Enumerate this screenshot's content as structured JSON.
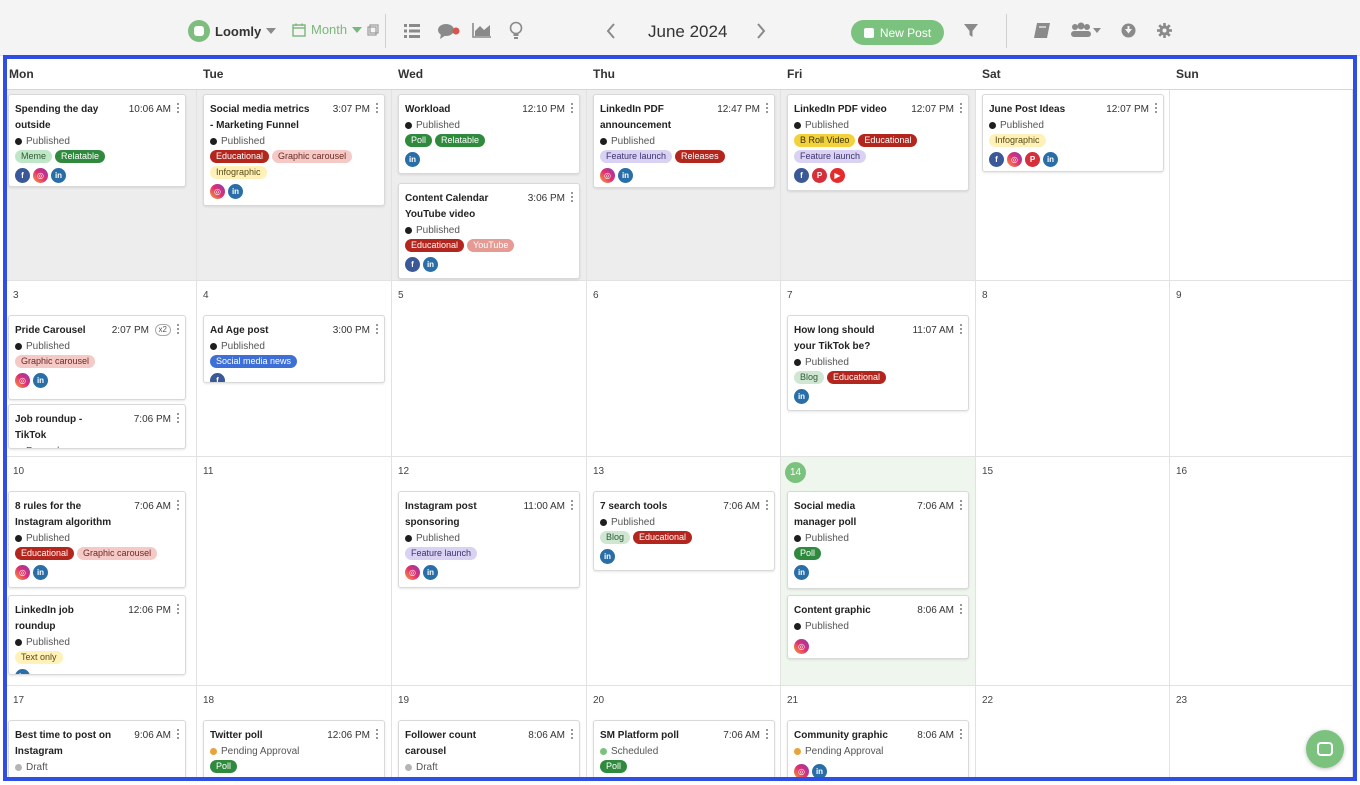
{
  "toolbar": {
    "brand": "Loomly",
    "view": "Month",
    "month_title": "June 2024",
    "new_post": "New Post",
    "accent": "#7bc27f",
    "icons": [
      "list-view-icon",
      "comments-icon",
      "analytics-icon",
      "ideas-icon",
      "filter-icon",
      "library-icon",
      "team-icon",
      "download-icon",
      "settings-icon"
    ]
  },
  "day_headers": [
    "Mon",
    "Tue",
    "Wed",
    "Thu",
    "Fri",
    "Sat",
    "Sun"
  ],
  "weeks": [
    {
      "days": [
        {
          "num": "",
          "gray": true,
          "posts": [
            {
              "title": "Spending the day outside",
              "time": "10:06 AM",
              "status": "Published",
              "tags": [
                [
                  "Meme",
                  "#bfe6c6",
                  "#2c5c34"
                ],
                [
                  "Relatable",
                  "#2f8a3e",
                  "#fff"
                ]
              ],
              "nets": [
                "facebook",
                "instagram",
                "linkedin"
              ]
            }
          ]
        },
        {
          "num": "",
          "gray": true,
          "posts": [
            {
              "title": "Social media metrics - Marketing Funnel",
              "time": "3:07 PM",
              "status": "Published",
              "tags": [
                [
                  "Educational",
                  "#b3261e",
                  "#fff"
                ],
                [
                  "Graphic carousel",
                  "#f4c9c6",
                  "#6b2a25"
                ],
                [
                  "Infographic",
                  "#fff1b8",
                  "#5a4a10"
                ]
              ],
              "nets": [
                "instagram",
                "linkedin"
              ]
            }
          ]
        },
        {
          "num": "",
          "gray": true,
          "posts": [
            {
              "title": "Workload",
              "time": "12:10 PM",
              "status": "Published",
              "tags": [
                [
                  "Poll",
                  "#2f8a3e",
                  "#fff"
                ],
                [
                  "Relatable",
                  "#2f8a3e",
                  "#fff"
                ]
              ],
              "nets": [
                "linkedin"
              ]
            },
            {
              "title": "Content Calendar YouTube video",
              "time": "3:06 PM",
              "status": "Published",
              "tags": [
                [
                  "Educational",
                  "#b3261e",
                  "#fff"
                ],
                [
                  "YouTube",
                  "#e59a93",
                  "#fff"
                ]
              ],
              "nets": [
                "facebook",
                "linkedin"
              ]
            }
          ]
        },
        {
          "num": "",
          "gray": true,
          "posts": [
            {
              "title": "LinkedIn PDF announcement",
              "time": "12:47 PM",
              "status": "Published",
              "tags": [
                [
                  "Feature launch",
                  "#d9d2f2",
                  "#3e3470"
                ],
                [
                  "Releases",
                  "#b3261e",
                  "#fff"
                ]
              ],
              "nets": [
                "instagram",
                "linkedin"
              ]
            }
          ]
        },
        {
          "num": "",
          "gray": true,
          "posts": [
            {
              "title": "LinkedIn PDF video",
              "time": "12:07 PM",
              "status": "Published",
              "tags": [
                [
                  "B Roll Video",
                  "#f2d23c",
                  "#3a3000"
                ],
                [
                  "Educational",
                  "#b3261e",
                  "#fff"
                ],
                [
                  "Feature launch",
                  "#d9d2f2",
                  "#3e3470"
                ]
              ],
              "nets": [
                "facebook",
                "pinterest",
                "youtube"
              ]
            }
          ]
        },
        {
          "num": "",
          "gray": false,
          "posts": [
            {
              "title": "June Post Ideas",
              "time": "12:07 PM",
              "status": "Published",
              "tags": [
                [
                  "Infographic",
                  "#fff1b8",
                  "#5a4a10"
                ]
              ],
              "nets": [
                "facebook",
                "instagram",
                "pinterest",
                "linkedin"
              ]
            }
          ]
        },
        {
          "num": "",
          "gray": false,
          "posts": []
        }
      ]
    },
    {
      "days": [
        {
          "num": "3",
          "posts": [
            {
              "title": "Pride Carousel",
              "time": "2:07 PM",
              "badge": "x2",
              "status": "Published",
              "tags": [
                [
                  "Graphic carousel",
                  "#f4c9c6",
                  "#6b2a25"
                ]
              ],
              "nets": [
                "instagram",
                "linkedin"
              ]
            },
            {
              "title": "Job roundup - TikTok",
              "time": "7:06 PM",
              "status": "Passed",
              "status_color": "purple",
              "tags": [],
              "nets": []
            }
          ]
        },
        {
          "num": "4",
          "posts": [
            {
              "title": "Ad Age post",
              "time": "3:00 PM",
              "status": "Published",
              "tags": [
                [
                  "Social media news",
                  "#3d6fd6",
                  "#fff"
                ]
              ],
              "nets": [
                "facebook"
              ]
            }
          ]
        },
        {
          "num": "5",
          "posts": []
        },
        {
          "num": "6",
          "posts": []
        },
        {
          "num": "7",
          "posts": [
            {
              "title": "How long should your TikTok be?",
              "time": "11:07 AM",
              "status": "Published",
              "tags": [
                [
                  "Blog",
                  "#cfe6d2",
                  "#2c5c34"
                ],
                [
                  "Educational",
                  "#b3261e",
                  "#fff"
                ]
              ],
              "nets": [
                "linkedin"
              ]
            }
          ]
        },
        {
          "num": "8",
          "posts": []
        },
        {
          "num": "9",
          "posts": []
        }
      ]
    },
    {
      "days": [
        {
          "num": "10",
          "posts": [
            {
              "title": "8 rules for the Instagram algorithm",
              "time": "7:06 AM",
              "status": "Published",
              "tags": [
                [
                  "Educational",
                  "#b3261e",
                  "#fff"
                ],
                [
                  "Graphic carousel",
                  "#f4c9c6",
                  "#6b2a25"
                ]
              ],
              "nets": [
                "instagram",
                "linkedin"
              ]
            },
            {
              "title": "LinkedIn job roundup",
              "time": "12:06 PM",
              "status": "Published",
              "tags": [
                [
                  "Text only",
                  "#fff1b8",
                  "#5a4a10"
                ]
              ],
              "nets": [
                "linkedin"
              ]
            }
          ]
        },
        {
          "num": "11",
          "posts": []
        },
        {
          "num": "12",
          "posts": [
            {
              "title": "Instagram post sponsoring",
              "time": "11:00 AM",
              "status": "Published",
              "tags": [
                [
                  "Feature launch",
                  "#d9d2f2",
                  "#3e3470"
                ]
              ],
              "nets": [
                "instagram",
                "linkedin"
              ]
            }
          ]
        },
        {
          "num": "13",
          "posts": [
            {
              "title": "7 search tools",
              "time": "7:06 AM",
              "status": "Published",
              "tags": [
                [
                  "Blog",
                  "#cfe6d2",
                  "#2c5c34"
                ],
                [
                  "Educational",
                  "#b3261e",
                  "#fff"
                ]
              ],
              "nets": [
                "linkedin"
              ]
            }
          ]
        },
        {
          "num": "14",
          "today": true,
          "posts": [
            {
              "title": "Social media manager poll",
              "time": "7:06 AM",
              "status": "Published",
              "tags": [
                [
                  "Poll",
                  "#2f8a3e",
                  "#fff"
                ]
              ],
              "nets": [
                "linkedin"
              ]
            },
            {
              "title": "Content graphic",
              "time": "8:06 AM",
              "status": "Published",
              "tags": [],
              "nets": [
                "instagram"
              ]
            }
          ]
        },
        {
          "num": "15",
          "posts": []
        },
        {
          "num": "16",
          "posts": []
        }
      ]
    },
    {
      "days": [
        {
          "num": "17",
          "posts": [
            {
              "title": "Best time to post on Instagram",
              "time": "9:06 AM",
              "status": "Draft",
              "status_color": "gray",
              "tags": [],
              "nets": []
            }
          ]
        },
        {
          "num": "18",
          "posts": [
            {
              "title": "Twitter poll",
              "time": "12:06 PM",
              "status": "Pending Approval",
              "status_color": "orange",
              "tags": [
                [
                  "Poll",
                  "#2f8a3e",
                  "#fff"
                ]
              ],
              "nets": []
            }
          ]
        },
        {
          "num": "19",
          "posts": [
            {
              "title": "Follower count carousel",
              "time": "8:06 AM",
              "status": "Draft",
              "status_color": "gray",
              "tags": [],
              "nets": [
                "instagram",
                "linkedin"
              ]
            }
          ]
        },
        {
          "num": "20",
          "posts": [
            {
              "title": "SM Platform poll",
              "time": "7:06 AM",
              "status": "Scheduled",
              "status_color": "green",
              "tags": [
                [
                  "Poll",
                  "#2f8a3e",
                  "#fff"
                ]
              ],
              "nets": []
            }
          ]
        },
        {
          "num": "21",
          "posts": [
            {
              "title": "Community graphic",
              "time": "8:06 AM",
              "status": "Pending Approval",
              "status_color": "orange",
              "tags": [],
              "nets": [
                "instagram",
                "linkedin"
              ]
            }
          ]
        },
        {
          "num": "22",
          "posts": []
        },
        {
          "num": "23",
          "posts": []
        }
      ]
    }
  ]
}
